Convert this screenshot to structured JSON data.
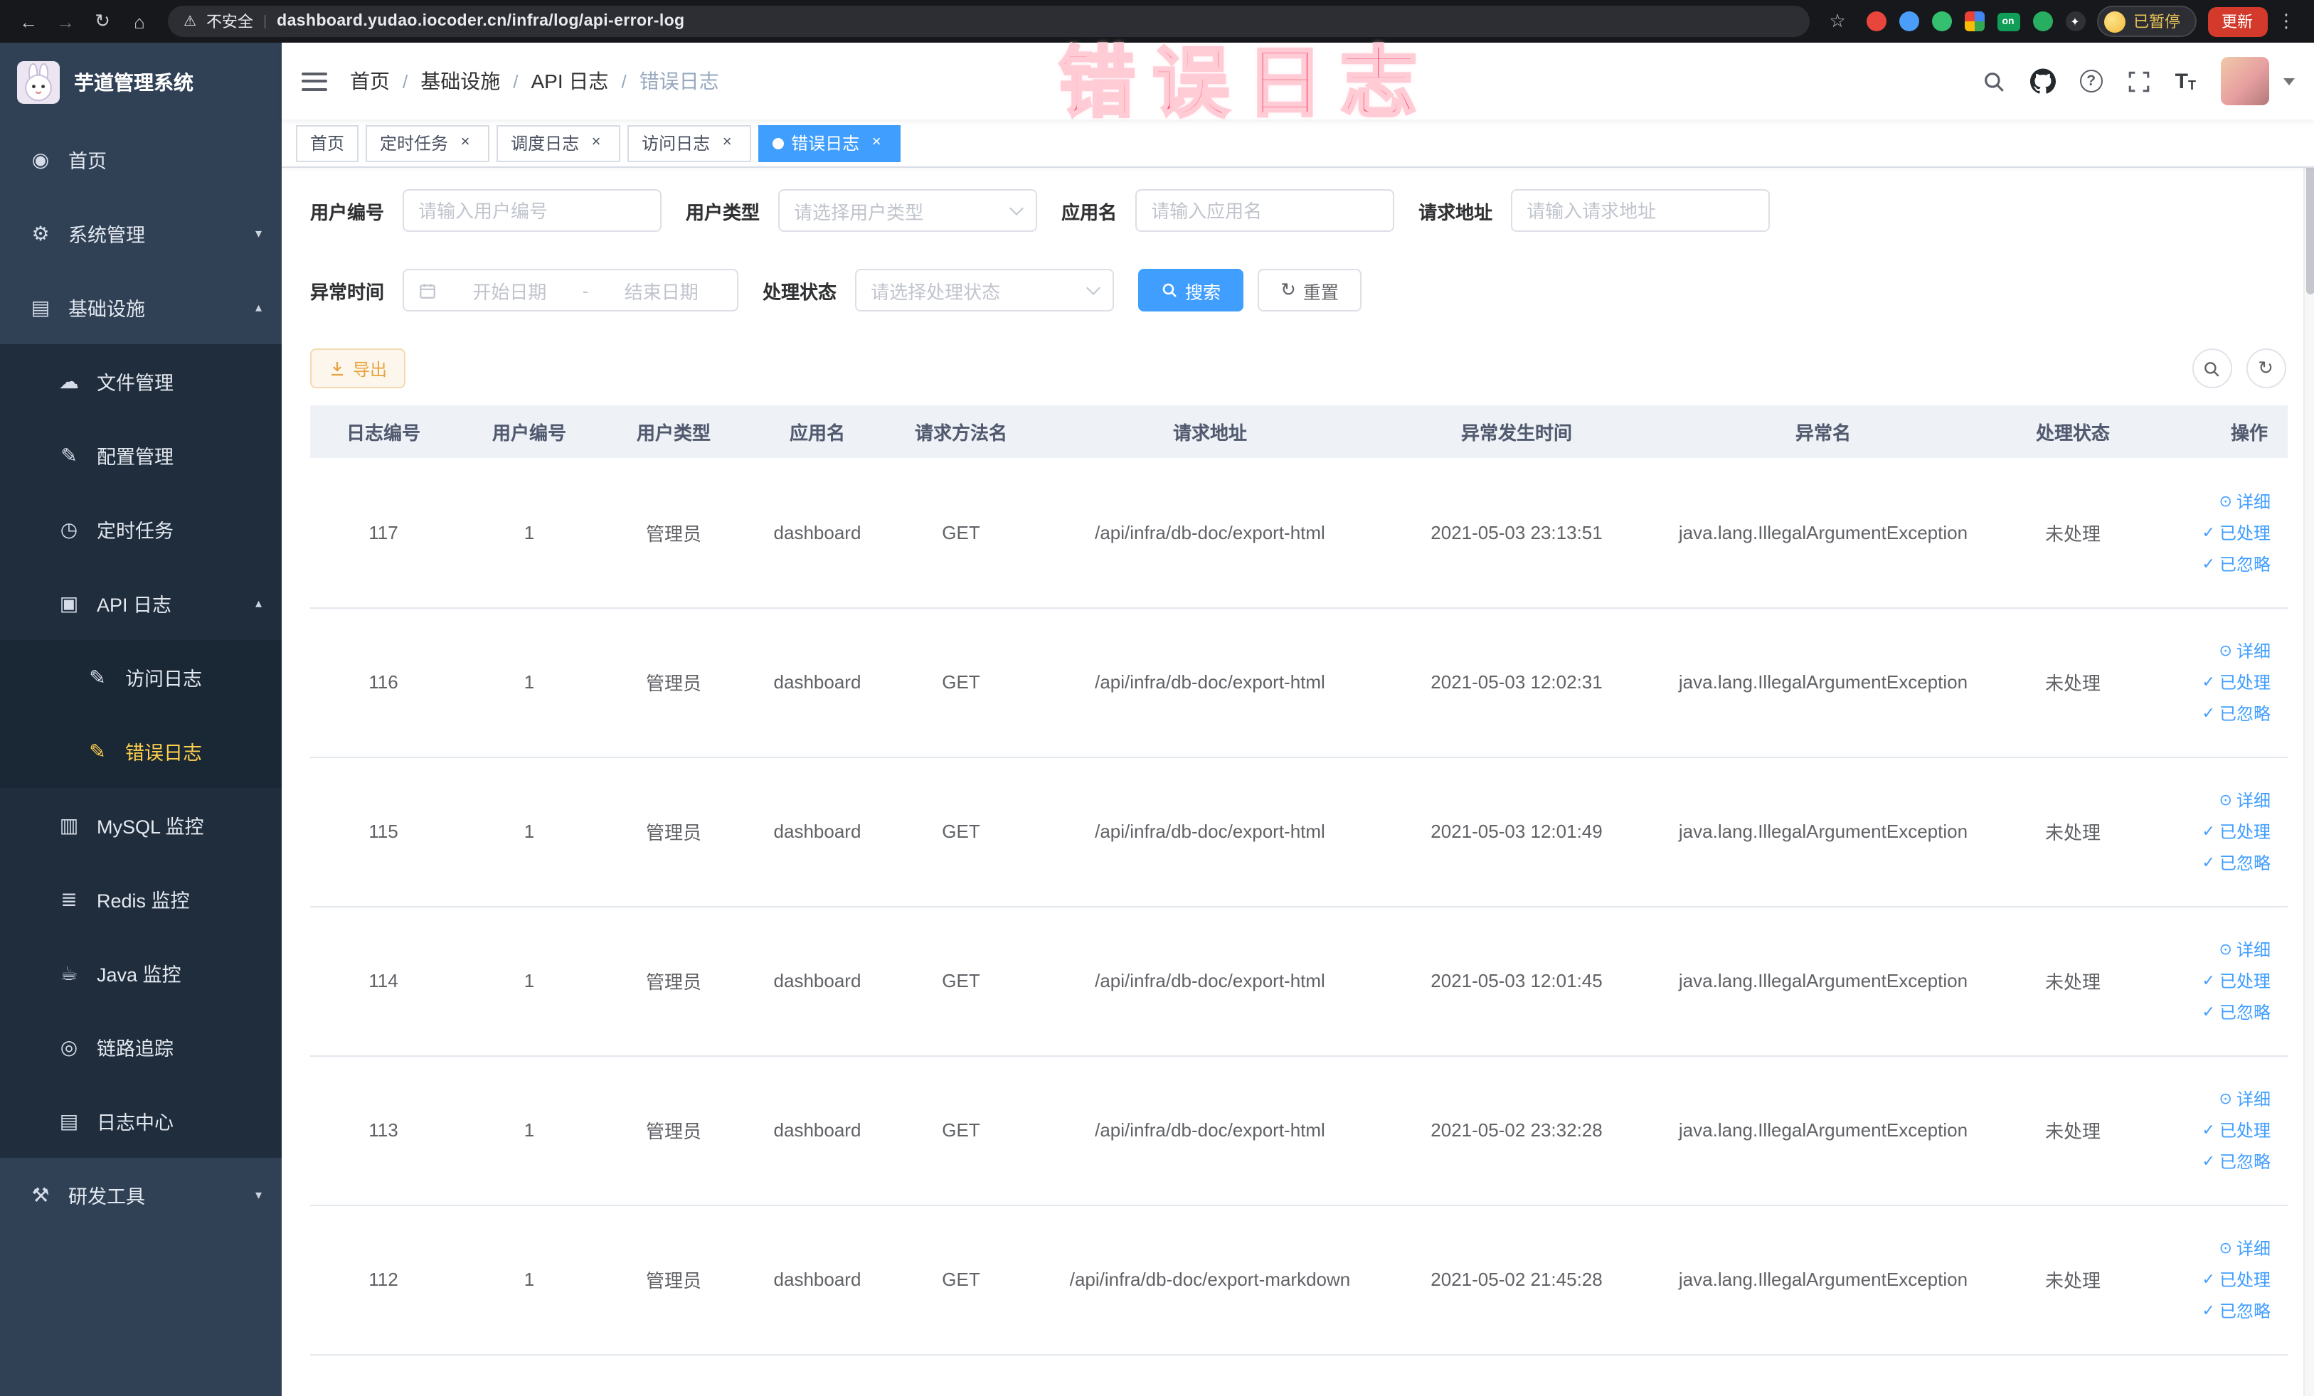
{
  "browser": {
    "security_label": "不安全",
    "url": "dashboard.yudao.iocoder.cn/infra/log/api-error-log",
    "profile_chip": "已暂停",
    "update_button": "更新",
    "extension_icons": [
      "bookmark-star-icon",
      "red-extension-icon",
      "blue-extension-icon",
      "green-extension-icon",
      "google-apps-icon",
      "on-badge-icon",
      "leaf-extension-icon",
      "dark-extension-icon"
    ]
  },
  "watermark": "错误日志",
  "sidebar": {
    "logo_title": "芋道管理系统",
    "items": [
      {
        "key": "home",
        "label": "首页",
        "icon": "dashboard-icon",
        "depth": 0
      },
      {
        "key": "system",
        "label": "系统管理",
        "icon": "gear-icon",
        "depth": 0,
        "arrow": "down"
      },
      {
        "key": "infrastructure",
        "label": "基础设施",
        "icon": "infrastructure-icon",
        "depth": 0,
        "arrow": "up"
      },
      {
        "key": "file",
        "label": "文件管理",
        "icon": "file-icon",
        "depth": 1
      },
      {
        "key": "config",
        "label": "配置管理",
        "icon": "config-icon",
        "depth": 1
      },
      {
        "key": "job",
        "label": "定时任务",
        "icon": "timer-icon",
        "depth": 1
      },
      {
        "key": "api-log",
        "label": "API 日志",
        "icon": "api-log-icon",
        "depth": 1,
        "arrow": "up"
      },
      {
        "key": "access-log",
        "label": "访问日志",
        "icon": "access-log-icon",
        "depth": 2
      },
      {
        "key": "error-log",
        "label": "错误日志",
        "icon": "error-log-icon",
        "depth": 2,
        "active": true
      },
      {
        "key": "mysql",
        "label": "MySQL 监控",
        "icon": "mysql-icon",
        "depth": 1
      },
      {
        "key": "redis",
        "label": "Redis 监控",
        "icon": "redis-icon",
        "depth": 1
      },
      {
        "key": "java",
        "label": "Java 监控",
        "icon": "java-icon",
        "depth": 1
      },
      {
        "key": "trace",
        "label": "链路追踪",
        "icon": "trace-icon",
        "depth": 1
      },
      {
        "key": "log-center",
        "label": "日志中心",
        "icon": "log-center-icon",
        "depth": 1
      },
      {
        "key": "dev-tools",
        "label": "研发工具",
        "icon": "tools-icon",
        "depth": 0,
        "arrow": "down"
      }
    ]
  },
  "breadcrumb": {
    "separator": "/",
    "items": [
      "首页",
      "基础设施",
      "API 日志",
      "错误日志"
    ]
  },
  "tags": [
    {
      "label": "首页",
      "closable": false,
      "active": false
    },
    {
      "label": "定时任务",
      "closable": true,
      "active": false
    },
    {
      "label": "调度日志",
      "closable": true,
      "active": false
    },
    {
      "label": "访问日志",
      "closable": true,
      "active": false
    },
    {
      "label": "错误日志",
      "closable": true,
      "active": true
    }
  ],
  "filters": {
    "user_id": {
      "label": "用户编号",
      "placeholder": "请输入用户编号"
    },
    "user_type": {
      "label": "用户类型",
      "placeholder": "请选择用户类型"
    },
    "app_name": {
      "label": "应用名",
      "placeholder": "请输入应用名"
    },
    "request_url": {
      "label": "请求地址",
      "placeholder": "请输入请求地址"
    },
    "exception_time": {
      "label": "异常时间",
      "start_placeholder": "开始日期",
      "separator": "-",
      "end_placeholder": "结束日期"
    },
    "process_status": {
      "label": "处理状态",
      "placeholder": "请选择处理状态"
    },
    "search_label": "搜索",
    "reset_label": "重置"
  },
  "toolbar": {
    "export_label": "导出"
  },
  "table": {
    "columns": [
      "日志编号",
      "用户编号",
      "用户类型",
      "应用名",
      "请求方法名",
      "请求地址",
      "异常发生时间",
      "异常名",
      "处理状态",
      "操作"
    ],
    "actions": [
      "详细",
      "已处理",
      "已忽略"
    ],
    "rows": [
      {
        "log_id": "117",
        "user_id": "1",
        "user_type": "管理员",
        "app_name": "dashboard",
        "method": "GET",
        "request_url": "/api/infra/db-doc/export-html",
        "time": "2021-05-03 23:13:51",
        "exception": "java.lang.IllegalArgumentException",
        "status": "未处理"
      },
      {
        "log_id": "116",
        "user_id": "1",
        "user_type": "管理员",
        "app_name": "dashboard",
        "method": "GET",
        "request_url": "/api/infra/db-doc/export-html",
        "time": "2021-05-03 12:02:31",
        "exception": "java.lang.IllegalArgumentException",
        "status": "未处理"
      },
      {
        "log_id": "115",
        "user_id": "1",
        "user_type": "管理员",
        "app_name": "dashboard",
        "method": "GET",
        "request_url": "/api/infra/db-doc/export-html",
        "time": "2021-05-03 12:01:49",
        "exception": "java.lang.IllegalArgumentException",
        "status": "未处理"
      },
      {
        "log_id": "114",
        "user_id": "1",
        "user_type": "管理员",
        "app_name": "dashboard",
        "method": "GET",
        "request_url": "/api/infra/db-doc/export-html",
        "time": "2021-05-03 12:01:45",
        "exception": "java.lang.IllegalArgumentException",
        "status": "未处理"
      },
      {
        "log_id": "113",
        "user_id": "1",
        "user_type": "管理员",
        "app_name": "dashboard",
        "method": "GET",
        "request_url": "/api/infra/db-doc/export-html",
        "time": "2021-05-02 23:32:28",
        "exception": "java.lang.IllegalArgumentException",
        "status": "未处理"
      },
      {
        "log_id": "112",
        "user_id": "1",
        "user_type": "管理员",
        "app_name": "dashboard",
        "method": "GET",
        "request_url": "/api/infra/db-doc/export-markdown",
        "time": "2021-05-02 21:45:28",
        "exception": "java.lang.IllegalArgumentException",
        "status": "未处理"
      }
    ]
  },
  "colors": {
    "accent": "#409eff",
    "sidebar_bg": "#304156",
    "submenu_bg": "#1f2d3d",
    "active_menu_text": "#ffd04b",
    "watermark_pink": "#fb3e63",
    "export_warning": "#e6a23c",
    "update_button_red": "#d33a2c"
  }
}
